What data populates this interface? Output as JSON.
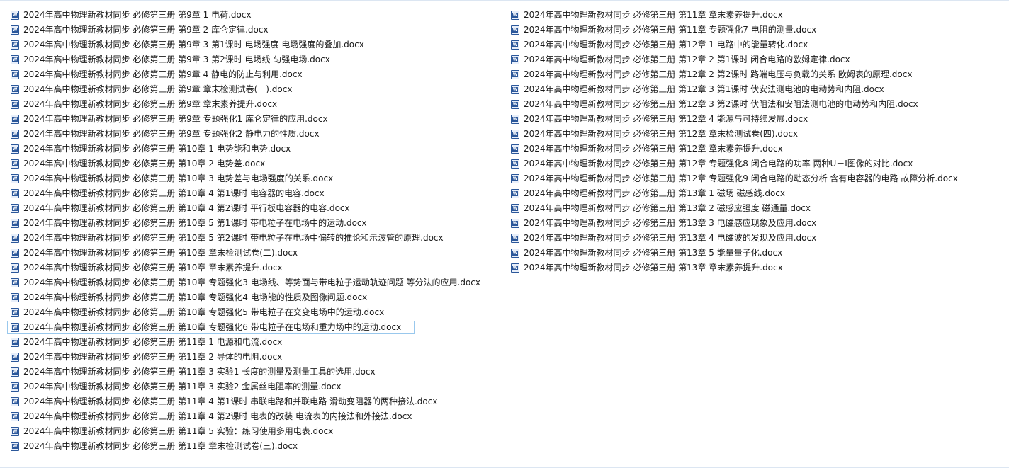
{
  "file_list": {
    "left_column": [
      "2024年高中物理新教材同步 必修第三册  第9章   1   电荷.docx",
      "2024年高中物理新教材同步 必修第三册  第9章   2   库仑定律.docx",
      "2024年高中物理新教材同步 必修第三册  第9章   3   第1课时   电场强度   电场强度的叠加.docx",
      "2024年高中物理新教材同步 必修第三册  第9章   3   第2课时   电场线   匀强电场.docx",
      "2024年高中物理新教材同步 必修第三册  第9章   4   静电的防止与利用.docx",
      "2024年高中物理新教材同步 必修第三册  第9章   章末检测试卷(一).docx",
      "2024年高中物理新教材同步 必修第三册  第9章   章末素养提升.docx",
      "2024年高中物理新教材同步 必修第三册  第9章   专题强化1   库仑定律的应用.docx",
      "2024年高中物理新教材同步 必修第三册  第9章   专题强化2   静电力的性质.docx",
      "2024年高中物理新教材同步 必修第三册  第10章   1   电势能和电势.docx",
      "2024年高中物理新教材同步 必修第三册  第10章   2   电势差.docx",
      "2024年高中物理新教材同步 必修第三册  第10章   3   电势差与电场强度的关系.docx",
      "2024年高中物理新教材同步 必修第三册  第10章   4   第1课时   电容器的电容.docx",
      "2024年高中物理新教材同步 必修第三册  第10章   4   第2课时   平行板电容器的电容.docx",
      "2024年高中物理新教材同步 必修第三册  第10章   5   第1课时   带电粒子在电场中的运动.docx",
      "2024年高中物理新教材同步 必修第三册  第10章   5   第2课时   带电粒子在电场中偏转的推论和示波管的原理.docx",
      "2024年高中物理新教材同步 必修第三册  第10章   章末检测试卷(二).docx",
      "2024年高中物理新教材同步 必修第三册  第10章   章末素养提升.docx",
      "2024年高中物理新教材同步 必修第三册  第10章   专题强化3   电场线、等势面与带电粒子运动轨迹问题   等分法的应用.docx",
      "2024年高中物理新教材同步 必修第三册  第10章   专题强化4   电场能的性质及图像问题.docx",
      "2024年高中物理新教材同步 必修第三册  第10章   专题强化5   带电粒子在交变电场中的运动.docx",
      "2024年高中物理新教材同步 必修第三册  第10章   专题强化6   带电粒子在电场和重力场中的运动.docx",
      "2024年高中物理新教材同步 必修第三册  第11章   1   电源和电流.docx",
      "2024年高中物理新教材同步 必修第三册  第11章   2   导体的电阻.docx",
      "2024年高中物理新教材同步 必修第三册  第11章   3   实验1   长度的测量及测量工具的选用.docx",
      "2024年高中物理新教材同步 必修第三册  第11章   3   实验2   金属丝电阻率的测量.docx",
      "2024年高中物理新教材同步 必修第三册  第11章   4   第1课时   串联电路和并联电路   滑动变阻器的两种接法.docx",
      "2024年高中物理新教材同步 必修第三册  第11章   4   第2课时   电表的改装   电流表的内接法和外接法.docx",
      "2024年高中物理新教材同步 必修第三册  第11章   5   实验：练习使用多用电表.docx",
      "2024年高中物理新教材同步 必修第三册  第11章   章末检测试卷(三).docx"
    ],
    "right_column": [
      "2024年高中物理新教材同步 必修第三册  第11章   章末素养提升.docx",
      "2024年高中物理新教材同步 必修第三册  第11章   专题强化7   电阻的测量.docx",
      "2024年高中物理新教材同步 必修第三册  第12章   1   电路中的能量转化.docx",
      "2024年高中物理新教材同步 必修第三册  第12章   2   第1课时   闭合电路的欧姆定律.docx",
      "2024年高中物理新教材同步 必修第三册  第12章   2   第2课时   路端电压与负载的关系   欧姆表的原理.docx",
      "2024年高中物理新教材同步 必修第三册  第12章   3   第1课时   伏安法测电池的电动势和内阻.docx",
      "2024年高中物理新教材同步 必修第三册  第12章   3   第2课时   伏阻法和安阻法测电池的电动势和内阻.docx",
      "2024年高中物理新教材同步 必修第三册  第12章   4   能源与可持续发展.docx",
      "2024年高中物理新教材同步 必修第三册  第12章   章末检测试卷(四).docx",
      "2024年高中物理新教材同步 必修第三册  第12章   章末素养提升.docx",
      "2024年高中物理新教材同步 必修第三册  第12章   专题强化8   闭合电路的功率   两种U－I图像的对比.docx",
      "2024年高中物理新教材同步 必修第三册  第12章   专题强化9   闭合电路的动态分析   含有电容器的电路   故障分析.docx",
      "2024年高中物理新教材同步 必修第三册  第13章   1   磁场   磁感线.docx",
      "2024年高中物理新教材同步 必修第三册  第13章   2   磁感应强度   磁通量.docx",
      "2024年高中物理新教材同步 必修第三册  第13章   3   电磁感应现象及应用.docx",
      "2024年高中物理新教材同步 必修第三册  第13章   4   电磁波的发现及应用.docx",
      "2024年高中物理新教材同步 必修第三册  第13章   5   能量量子化.docx",
      "2024年高中物理新教材同步 必修第三册  第13章   章末素养提升.docx"
    ],
    "selected": {
      "column": "left",
      "index": 21
    },
    "icon": "word-document-icon",
    "colors": {
      "icon": "#2b579a",
      "selection_border": "#99c8ed",
      "frame": "#dce6f2"
    }
  }
}
